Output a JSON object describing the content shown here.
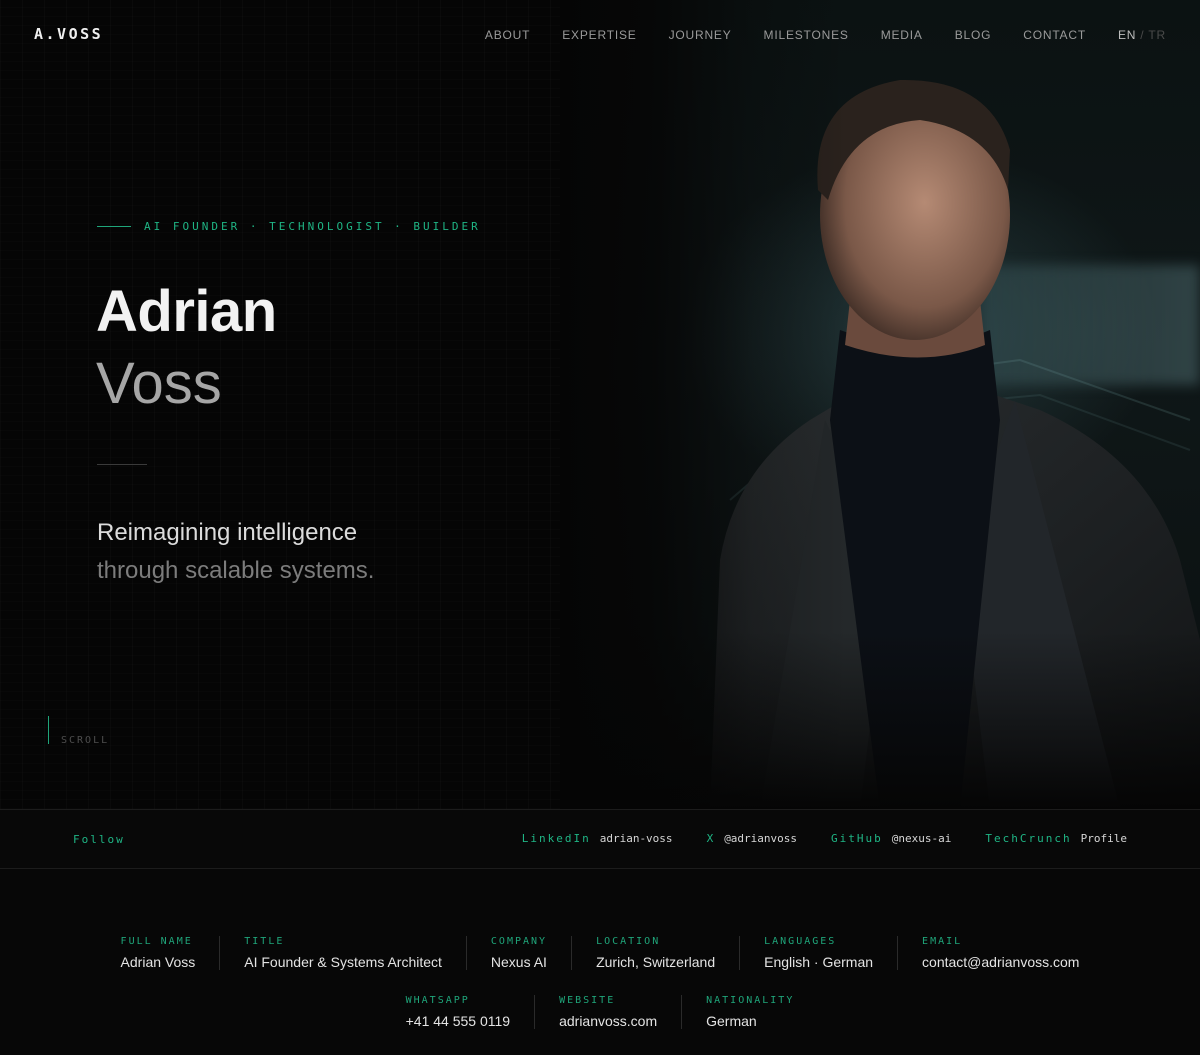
{
  "brand": {
    "logo": "A.VOSS"
  },
  "nav": {
    "links": [
      "ABOUT",
      "EXPERTISE",
      "JOURNEY",
      "MILESTONES",
      "MEDIA",
      "BLOG",
      "CONTACT"
    ],
    "lang": {
      "active": "EN",
      "separator": "/",
      "other": "TR"
    }
  },
  "hero": {
    "tagline": "AI FOUNDER · TECHNOLOGIST · BUILDER",
    "first_name": "Adrian",
    "last_name": "Voss",
    "lead_line1": "Reimagining intelligence",
    "lead_line2": "through scalable systems.",
    "scroll_label": "SCROLL"
  },
  "follow": {
    "label": "Follow",
    "links": [
      {
        "network": "LinkedIn",
        "handle": "adrian-voss"
      },
      {
        "network": "X",
        "handle": "@adrianvoss"
      },
      {
        "network": "GitHub",
        "handle": "@nexus-ai"
      },
      {
        "network": "TechCrunch",
        "handle": "Profile"
      }
    ]
  },
  "details": {
    "row1": [
      {
        "key": "FULL NAME",
        "value": "Adrian Voss"
      },
      {
        "key": "TITLE",
        "value": "AI Founder & Systems Architect"
      },
      {
        "key": "COMPANY",
        "value": "Nexus AI"
      },
      {
        "key": "LOCATION",
        "value": "Zurich, Switzerland"
      },
      {
        "key": "LANGUAGES",
        "value": "English · German"
      },
      {
        "key": "EMAIL",
        "value": "contact@adrianvoss.com"
      }
    ],
    "row2": [
      {
        "key": "WHATSAPP",
        "value": "+41 44 555 0119"
      },
      {
        "key": "WEBSITE",
        "value": "adrianvoss.com"
      },
      {
        "key": "NATIONALITY",
        "value": "German"
      }
    ]
  },
  "colors": {
    "accent": "#1fb585",
    "background": "#070707",
    "text": "#e8e8e8",
    "muted": "#7c7c7c"
  }
}
